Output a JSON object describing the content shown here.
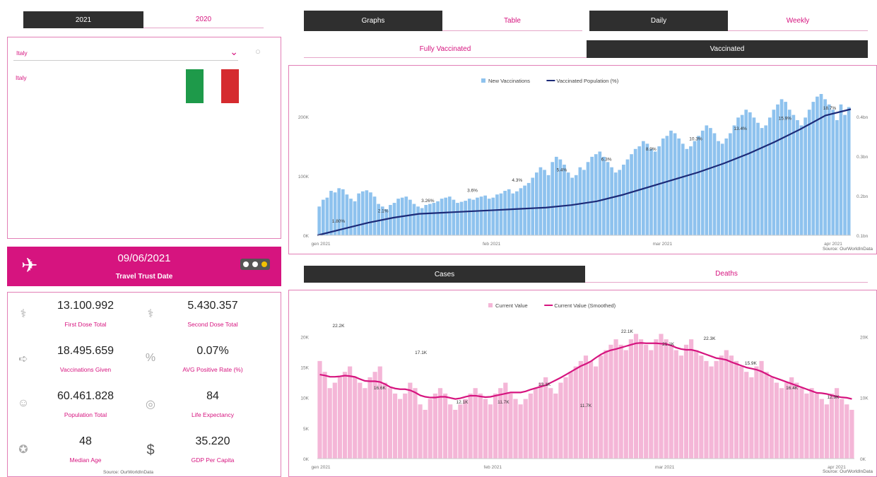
{
  "year_tabs": {
    "left": "2021",
    "right": "2020"
  },
  "view_tabs": {
    "graphs": "Graphs",
    "table": "Table",
    "daily": "Daily",
    "weekly": "Weekly"
  },
  "vacc_tabs": {
    "fully": "Fully Vaccinated",
    "vaccinated": "Vaccinated"
  },
  "outcome_tabs": {
    "cases": "Cases",
    "deaths": "Deaths"
  },
  "country_select": {
    "value": "Italy",
    "list_item": "Italy"
  },
  "flag_colors": {
    "green": "#1e9a4a",
    "white": "#ffffff",
    "red": "#d52b2f"
  },
  "banner": {
    "date": "09/06/2021",
    "label": "Travel Trust Date",
    "color": "#d6147f"
  },
  "stats": [
    {
      "icon": "syringe-person-icon",
      "value": "13.100.992",
      "label": "First Dose Total"
    },
    {
      "icon": "syringe-person-icon",
      "value": "5.430.357",
      "label": "Second Dose Total"
    },
    {
      "icon": "syringe-icon",
      "value": "18.495.659",
      "label": "Vaccinations Given"
    },
    {
      "icon": "percent-icon",
      "value": "0.07%",
      "label": "AVG Positive Rate (%)"
    },
    {
      "icon": "people-icon",
      "value": "60.461.828",
      "label": "Population Total"
    },
    {
      "icon": "target-icon",
      "value": "84",
      "label": "Life Expectancy"
    },
    {
      "icon": "medal-icon",
      "value": "48",
      "label": "Median Age"
    },
    {
      "icon": "dollar-icon",
      "value": "35.220",
      "label": "GDP Per Capita"
    }
  ],
  "source_left": "Source: OurWorldInData",
  "chart_data": [
    {
      "type": "bar",
      "legend": [
        "New Vaccinations",
        "Vaccinated Population (%)"
      ],
      "colors": {
        "bars": "#8ec2ee",
        "line": "#1c2a78"
      },
      "y_ticks_left": [
        "0K",
        "100K",
        "200K"
      ],
      "y_ticks_right": [
        "0.1bn",
        "0.2bn",
        "0.3bn",
        "0.4bn"
      ],
      "x_ticks": [
        "gen 2021",
        "feb 2021",
        "mar 2021",
        "apr 2021"
      ],
      "data_labels": [
        "1.80%",
        "2.1%",
        "3.26%",
        "3.6%",
        "4.3%",
        "5.4%",
        "6.3%",
        "8.9%",
        "10.3%",
        "13.4%",
        "15.9%",
        "18.7%"
      ],
      "bar_values": [
        55,
        68,
        72,
        85,
        82,
        90,
        88,
        78,
        70,
        65,
        80,
        84,
        86,
        82,
        74,
        60,
        55,
        50,
        58,
        62,
        70,
        72,
        74,
        68,
        60,
        55,
        52,
        58,
        60,
        62,
        65,
        70,
        72,
        74,
        68,
        62,
        64,
        66,
        70,
        68,
        72,
        74,
        76,
        70,
        72,
        78,
        80,
        85,
        88,
        80,
        84,
        90,
        95,
        100,
        110,
        120,
        130,
        125,
        115,
        140,
        150,
        145,
        135,
        120,
        110,
        115,
        130,
        125,
        140,
        150,
        155,
        160,
        150,
        140,
        130,
        120,
        125,
        135,
        145,
        155,
        165,
        170,
        180,
        175,
        165,
        160,
        170,
        185,
        190,
        200,
        195,
        185,
        175,
        165,
        170,
        180,
        190,
        200,
        210,
        205,
        195,
        180,
        175,
        185,
        195,
        210,
        225,
        230,
        240,
        235,
        225,
        215,
        205,
        210,
        225,
        240,
        250,
        260,
        255,
        240,
        230,
        220,
        210,
        225,
        240,
        255,
        265,
        270,
        260,
        250,
        240,
        220,
        250,
        230,
        245
      ],
      "line_values": [
        0.0,
        0.05,
        0.1,
        0.14,
        0.17,
        0.18,
        0.19,
        0.2,
        0.21,
        0.22,
        0.24,
        0.27,
        0.32,
        0.38,
        0.44,
        0.5,
        0.57,
        0.65,
        0.74,
        0.84,
        0.95,
        1.0
      ]
    },
    {
      "type": "bar",
      "legend": [
        "Current Value",
        "Current Value (Smoothed)"
      ],
      "colors": {
        "bars": "#f4b6d7",
        "line": "#d6147f"
      },
      "y_ticks_left": [
        "0K",
        "5K",
        "10K",
        "15K",
        "20K"
      ],
      "y_ticks_right": [
        "0K",
        "10K",
        "20K"
      ],
      "x_ticks": [
        "gen 2021",
        "feb 2021",
        "mar 2021",
        "apr 2021"
      ],
      "data_labels": [
        "22.2K",
        "16.6K",
        "17.1K",
        "12.1K",
        "11.7K",
        "13.1K",
        "11.7K",
        "22.1K",
        "21.1K",
        "22.3K",
        "15.9K",
        "16.4K",
        "12.9K"
      ],
      "bar_values": [
        18,
        16,
        13,
        14,
        15,
        16,
        17,
        15,
        14,
        13,
        15,
        16,
        17,
        14,
        13,
        12,
        11,
        12,
        14,
        13,
        10,
        9,
        11,
        12,
        13,
        12,
        10,
        9,
        10,
        11,
        12,
        13,
        12,
        11,
        10,
        12,
        13,
        14,
        12,
        11,
        10,
        11,
        12,
        13,
        14,
        15,
        13,
        12,
        14,
        15,
        16,
        17,
        18,
        19,
        18,
        17,
        19,
        20,
        21,
        22,
        21,
        20,
        22,
        23,
        22,
        21,
        20,
        22,
        23,
        22,
        21,
        20,
        19,
        21,
        22,
        20,
        19,
        18,
        17,
        18,
        19,
        20,
        19,
        18,
        17,
        16,
        15,
        17,
        18,
        16,
        15,
        14,
        13,
        14,
        15,
        14,
        13,
        12,
        13,
        12,
        11,
        10,
        12,
        13,
        11,
        10,
        9
      ]
    }
  ],
  "source_right": "Source: OurWorldInData"
}
